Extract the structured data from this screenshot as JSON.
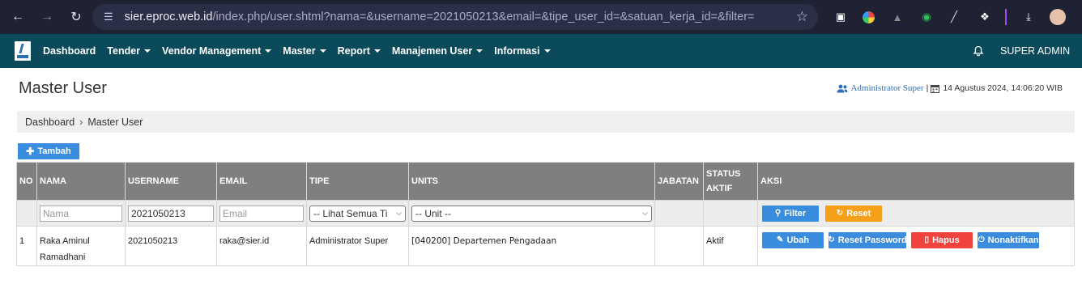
{
  "browser": {
    "url_host": "sier.eproc.web.id",
    "url_path": "/index.php/user.shtml?nama=&username=2021050213&email=&tipe_user_id=&satuan_kerja_id=&filter="
  },
  "navbar": {
    "items": [
      {
        "label": "Dashboard",
        "caret": false
      },
      {
        "label": "Tender",
        "caret": true
      },
      {
        "label": "Vendor Management",
        "caret": true
      },
      {
        "label": "Master",
        "caret": true
      },
      {
        "label": "Report",
        "caret": true
      },
      {
        "label": "Manajemen User",
        "caret": true
      },
      {
        "label": "Informasi",
        "caret": true
      }
    ],
    "user": "SUPER ADMIN"
  },
  "page": {
    "title": "Master User",
    "user_name": "Administrator Super",
    "separator": "|",
    "datetime": "14 Agustus 2024, 14:06:20 WIB"
  },
  "breadcrumb": {
    "home": "Dashboard",
    "current": "Master User"
  },
  "toolbar": {
    "add_label": "Tambah"
  },
  "table": {
    "headers": {
      "no": "NO",
      "nama": "NAMA",
      "username": "USERNAME",
      "email": "EMAIL",
      "tipe": "TIPE",
      "units": "UNITS",
      "jabatan": "JABATAN",
      "status_line1": "STATUS",
      "status_line2": "AKTIF",
      "aksi": "AKSI"
    },
    "filters": {
      "nama_placeholder": "Nama",
      "username_value": "2021050213",
      "email_placeholder": "Email",
      "tipe_selected": "-- Lihat Semua Ti",
      "unit_selected": "-- Unit --",
      "filter_label": "Filter",
      "reset_label": "Reset"
    },
    "rows": [
      {
        "no": "1",
        "nama_line1": "Raka Aminul",
        "nama_line2": "Ramadhani",
        "username": "2021050213",
        "email": "raka@sier.id",
        "tipe": "Administrator Super",
        "units": "[040200] Departemen Pengadaan",
        "jabatan": "",
        "status": "Aktif",
        "actions": {
          "ubah": "Ubah",
          "reset_password": "Reset Password",
          "hapus": "Hapus",
          "nonaktifkan": "Nonaktifkan"
        }
      }
    ]
  },
  "colors": {
    "navbar": "#0b4a5a",
    "header_bg": "#7f7f7f",
    "primary": "#3a8dde",
    "warning": "#f5a018",
    "danger": "#f0433e"
  }
}
